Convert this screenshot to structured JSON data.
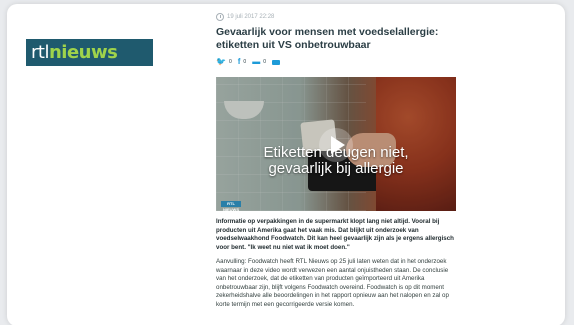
{
  "brand": {
    "logo_part1": "rtl",
    "logo_part2": "nieuws",
    "logo_bg": "#1f5a6e",
    "logo_accent": "#9fd34b"
  },
  "article": {
    "date": "19 juli 2017 22:28",
    "headline_line1": "Gevaarlijk voor mensen met voedselallergie:",
    "headline_line2": "etiketten uit VS onbetrouwbaar",
    "share": {
      "twitter_icon": "twitter-icon",
      "twitter_count": "0",
      "facebook_icon": "facebook-icon",
      "facebook_count": "0",
      "comments_icon": "comment-icon",
      "comments_count": "0",
      "mail_icon": "mail-icon"
    },
    "video": {
      "caption_line1": "Etiketten deugen niet,",
      "caption_line2": "gevaarlijk bij allergie",
      "badge": "RTL NIEUWS",
      "play_icon": "play-icon"
    },
    "intro": "Informatie op verpakkingen in de supermarkt klopt lang niet altijd. Vooral bij producten uit Amerika gaat het vaak mis. Dat blijkt uit onderzoek van voedselwaakhond Foodwatch. Dit kan heel gevaarlijk zijn als je ergens allergisch voor bent. \"Ik weet nu niet wat ik moet doen.\"",
    "body": "Aanvulling: Foodwatch heeft RTL Nieuws op 25 juli laten weten dat in het onderzoek waarnaar in deze video wordt verwezen een aantal onjuistheden staan. De conclusie van het onderzoek, dat de etiketten van producten geïmporteerd uit Amerika onbetrouwbaar zijn, blijft volgens Foodwatch overeind. Foodwatch is op dit moment zekerheidshalve alle beoordelingen in het rapport opnieuw aan het nalopen en zal op korte termijn met een gecorrigeerde versie komen."
  },
  "colors": {
    "headline": "#2b3e45",
    "meta": "#a7b0b6",
    "share_accent": "#1d9bd8"
  }
}
